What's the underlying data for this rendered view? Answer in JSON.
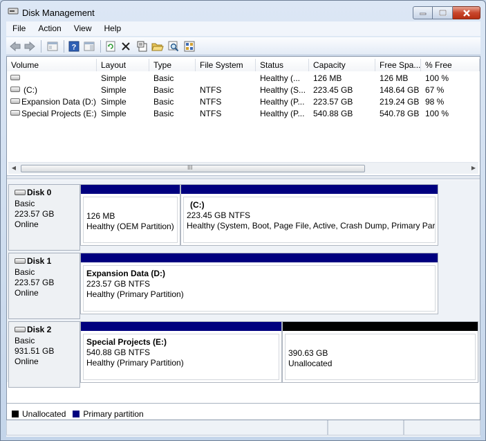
{
  "window": {
    "title": "Disk Management"
  },
  "menu": [
    "File",
    "Action",
    "View",
    "Help"
  ],
  "toolbar": {
    "icons": [
      "back-arrow-icon",
      "forward-arrow-icon",
      "show-hide-tree-icon",
      "help-icon",
      "properties-pane-icon",
      "refresh-icon",
      "delete-icon",
      "properties-icon",
      "open-icon",
      "search-icon",
      "settings-icon"
    ]
  },
  "volume_list": {
    "headers": [
      "Volume",
      "Layout",
      "Type",
      "File System",
      "Status",
      "Capacity",
      "Free Spa...",
      "% Free"
    ],
    "rows": [
      {
        "volume": "",
        "layout": "Simple",
        "type": "Basic",
        "fs": "",
        "status": "Healthy (...",
        "capacity": "126 MB",
        "free": "126 MB",
        "pct": "100 %"
      },
      {
        "volume": "(C:)",
        "layout": "Simple",
        "type": "Basic",
        "fs": "NTFS",
        "status": "Healthy (S...",
        "capacity": "223.45 GB",
        "free": "148.64 GB",
        "pct": "67 %"
      },
      {
        "volume": "Expansion Data (D:)",
        "layout": "Simple",
        "type": "Basic",
        "fs": "NTFS",
        "status": "Healthy (P...",
        "capacity": "223.57 GB",
        "free": "219.24 GB",
        "pct": "98 %"
      },
      {
        "volume": "Special Projects (E:)",
        "layout": "Simple",
        "type": "Basic",
        "fs": "NTFS",
        "status": "Healthy (P...",
        "capacity": "540.88 GB",
        "free": "540.78 GB",
        "pct": "100 %"
      }
    ],
    "scroll_grip": "III"
  },
  "disks": [
    {
      "name": "Disk 0",
      "type": "Basic",
      "size": "223.57 GB",
      "state": "Online",
      "partitions": [
        {
          "title": "",
          "line1": "126 MB",
          "line2": "Healthy (OEM Partition)",
          "kind": "primary"
        },
        {
          "title": "(C:)",
          "line1": "223.45 GB NTFS",
          "line2": "Healthy (System, Boot, Page File, Active, Crash Dump, Primary Partition)",
          "kind": "primary"
        }
      ]
    },
    {
      "name": "Disk 1",
      "type": "Basic",
      "size": "223.57 GB",
      "state": "Online",
      "partitions": [
        {
          "title": "Expansion Data  (D:)",
          "line1": "223.57 GB NTFS",
          "line2": "Healthy (Primary Partition)",
          "kind": "primary"
        }
      ]
    },
    {
      "name": "Disk 2",
      "type": "Basic",
      "size": "931.51 GB",
      "state": "Online",
      "partitions": [
        {
          "title": "Special Projects  (E:)",
          "line1": "540.88 GB NTFS",
          "line2": "Healthy (Primary Partition)",
          "kind": "primary"
        },
        {
          "title": "",
          "line1": "390.63 GB",
          "line2": "Unallocated",
          "kind": "unallocated"
        }
      ]
    }
  ],
  "legend": [
    {
      "label": "Unallocated",
      "color": "#000000"
    },
    {
      "label": "Primary partition",
      "color": "#00007f"
    }
  ],
  "colors": {
    "primary": "#00007f",
    "unallocated": "#000000"
  }
}
